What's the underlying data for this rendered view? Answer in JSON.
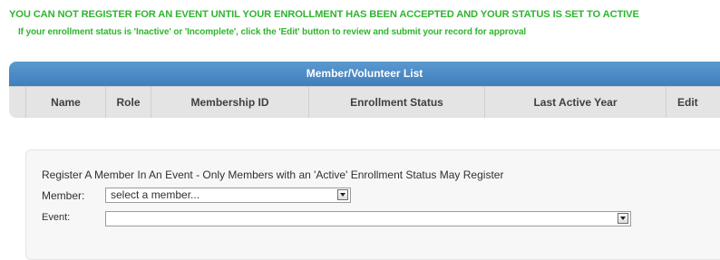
{
  "notices": {
    "main": "YOU CAN NOT REGISTER FOR AN EVENT UNTIL YOUR ENROLLMENT HAS BEEN ACCEPTED AND YOUR STATUS IS SET TO ACTIVE",
    "sub": "If your enrollment status is 'Inactive' or 'Incomplete', click the 'Edit' button to review and submit your record for approval"
  },
  "member_list": {
    "title": "Member/Volunteer List",
    "columns": [
      "Name",
      "Role",
      "Membership ID",
      "Enrollment Status",
      "Last Active Year",
      "Edit"
    ]
  },
  "register": {
    "title": "Register A Member In An Event - Only Members with an 'Active' Enrollment Status May Register",
    "member_label": "Member:",
    "member_selected": "select a member...",
    "event_label": "Event:",
    "event_selected": ""
  },
  "colors": {
    "notice_green": "#2fb52f",
    "header_blue": "#4a89c6",
    "column_header_bg": "#e4e4e4"
  },
  "icons": {
    "dropdown": "chevron-down-icon"
  }
}
